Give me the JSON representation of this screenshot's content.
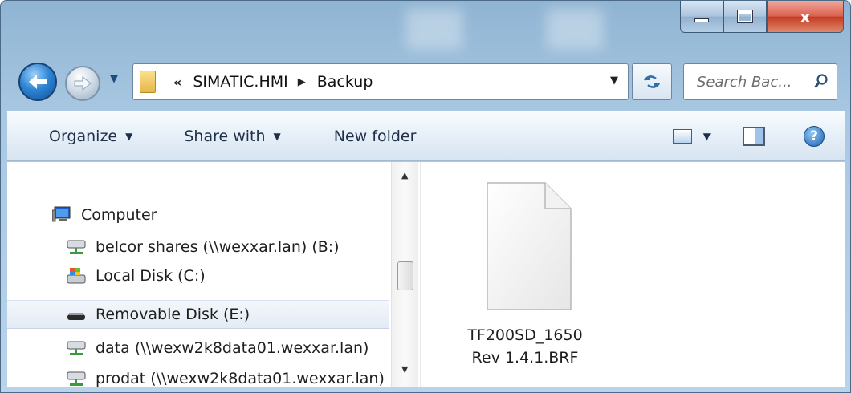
{
  "window": {
    "caption": {
      "close_label": "x"
    }
  },
  "nav": {
    "breadcrumb_overflow": "«",
    "breadcrumb": [
      "SIMATIC.HMI",
      "Backup"
    ],
    "search_placeholder": "Search Bac..."
  },
  "toolbar": {
    "organize_label": "Organize",
    "share_label": "Share with",
    "new_folder_label": "New folder",
    "help_label": "?"
  },
  "sidebar": {
    "items": [
      {
        "label": "Computer",
        "icon": "computer-icon"
      },
      {
        "label": "belcor shares (\\\\wexxar.lan) (B:)",
        "icon": "network-drive-icon"
      },
      {
        "label": "Local Disk (C:)",
        "icon": "local-disk-icon"
      },
      {
        "label": "Removable Disk (E:)",
        "icon": "removable-disk-icon",
        "selected": true
      },
      {
        "label": "data (\\\\wexw2k8data01.wexxar.lan)",
        "icon": "network-drive-icon"
      },
      {
        "label": "prodat (\\\\wexw2k8data01.wexxar.lan)",
        "icon": "network-drive-icon"
      }
    ]
  },
  "files": [
    {
      "name_line1": "TF200SD_1650",
      "name_line2": "Rev 1.4.1.BRF",
      "icon": "blank-file-icon"
    }
  ]
}
